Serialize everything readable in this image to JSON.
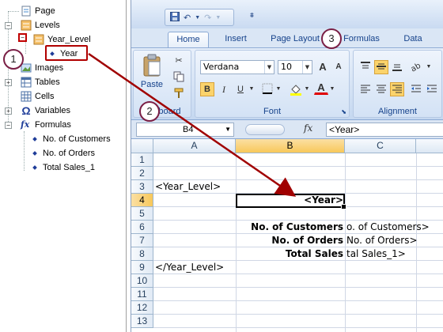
{
  "tree": {
    "items": [
      {
        "label": "Page",
        "icon": "page-icon"
      },
      {
        "label": "Levels",
        "icon": "levels-icon"
      },
      {
        "label": "Year_Level",
        "icon": "level-icon"
      },
      {
        "label": "Year",
        "icon": "field-dot-icon"
      },
      {
        "label": "Images",
        "icon": "images-icon"
      },
      {
        "label": "Tables",
        "icon": "tables-icon"
      },
      {
        "label": "Cells",
        "icon": "cells-icon"
      },
      {
        "label": "Variables",
        "icon": "omega-icon"
      },
      {
        "label": "Formulas",
        "icon": "fx-icon"
      },
      {
        "label": "No. of Customers",
        "icon": "field-dot-icon"
      },
      {
        "label": "No. of Orders",
        "icon": "field-dot-icon"
      },
      {
        "label": "Total Sales_1",
        "icon": "field-dot-icon"
      }
    ]
  },
  "excel": {
    "tabs": [
      "Home",
      "Insert",
      "Page Layout",
      "Formulas",
      "Data"
    ],
    "active_tab": "Home",
    "ribbon": {
      "paste_label": "Paste",
      "clipboard_label": "Clipboard",
      "font_label": "Font",
      "alignment_label": "Alignment",
      "font_name": "Verdana",
      "font_size": "10",
      "bold": "B",
      "italic": "I",
      "underline": "U",
      "grow_font": "A",
      "shrink_font": "A",
      "font_color": "A"
    },
    "formula_bar": {
      "name_box": "B4",
      "fx": "fx",
      "formula": "<Year>"
    },
    "columns": [
      "A",
      "B",
      "C"
    ],
    "rows": [
      "1",
      "2",
      "3",
      "4",
      "5",
      "6",
      "7",
      "8",
      "9",
      "10",
      "11",
      "12",
      "13"
    ],
    "selected_column": "B",
    "selected_row": "4",
    "cells": {
      "a3": "<Year_Level>",
      "b4": "<Year>",
      "b6": "No. of Customers",
      "c6": "o. of Customers>",
      "b7": "No. of Orders",
      "c7": "No. of Orders>",
      "b8": "Total Sales",
      "c8": "tal Sales_1>",
      "a9": "</Year_Level>"
    }
  },
  "callouts": [
    "1",
    "2",
    "3"
  ],
  "colors": {
    "accent_red": "#b00000",
    "callout_border": "#7a1f45",
    "selected_header": "#f8c85a",
    "ribbon_text": "#15428b"
  }
}
